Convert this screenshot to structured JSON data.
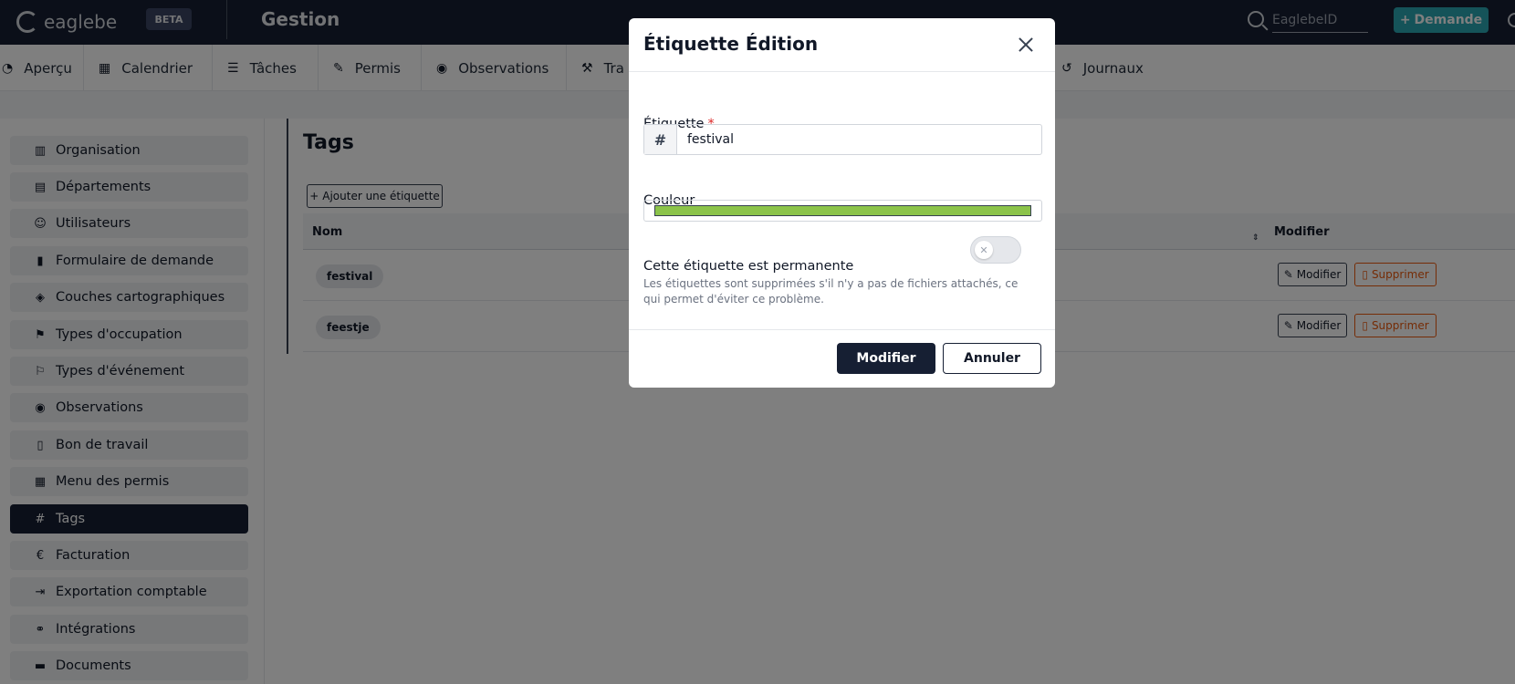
{
  "header": {
    "brand": "eaglebe",
    "beta_label": "BETA",
    "app_title": "Gestion",
    "search_placeholder": "EaglebeID",
    "demande_label": "Demande"
  },
  "nav": {
    "tabs": [
      {
        "label": "Aperçu",
        "icon": "gauge-icon"
      },
      {
        "label": "Calendrier",
        "icon": "calendar-icon"
      },
      {
        "label": "Tâches",
        "icon": "list-check-icon"
      },
      {
        "label": "Permis",
        "icon": "file-signature-icon"
      },
      {
        "label": "Observations",
        "icon": "eye-icon"
      },
      {
        "label": "Tra",
        "icon": "worker-icon"
      },
      {
        "label": "Journaux",
        "icon": "history-icon"
      }
    ]
  },
  "sidebar": {
    "items": [
      {
        "label": "Organisation",
        "icon": "building-icon"
      },
      {
        "label": "Départements",
        "icon": "table-icon"
      },
      {
        "label": "Utilisateurs",
        "icon": "users-icon"
      },
      {
        "label": "Formulaire de demande",
        "icon": "clipboard-icon"
      },
      {
        "label": "Couches cartographiques",
        "icon": "layers-icon"
      },
      {
        "label": "Types d'occupation",
        "icon": "signs-icon"
      },
      {
        "label": "Types d'événement",
        "icon": "flag-icon"
      },
      {
        "label": "Observations",
        "icon": "eye-icon"
      },
      {
        "label": "Bon de travail",
        "icon": "file-icon"
      },
      {
        "label": "Menu des permis",
        "icon": "grid-icon"
      },
      {
        "label": "Tags",
        "icon": "hashtag-icon",
        "active": true
      },
      {
        "label": "Facturation",
        "icon": "euro-icon"
      },
      {
        "label": "Exportation comptable",
        "icon": "file-export-icon"
      },
      {
        "label": "Intégrations",
        "icon": "handshake-icon"
      },
      {
        "label": "Documents",
        "icon": "folder-icon"
      }
    ]
  },
  "main": {
    "title": "Tags",
    "add_label": "Ajouter une étiquette",
    "columns": {
      "name": "Nom",
      "modify": "Modifier"
    },
    "rows": [
      {
        "tag": "festival",
        "edit_label": "Modifier",
        "delete_label": "Supprimer"
      },
      {
        "tag": "feestje",
        "edit_label": "Modifier",
        "delete_label": "Supprimer"
      }
    ]
  },
  "modal": {
    "title": "Étiquette Édition",
    "tag_label": "Étiquette",
    "required_mark": "*",
    "hash_prefix": "#",
    "tag_value": "festival",
    "color_label": "Couleur",
    "color_value": "#8bc34a",
    "permanent_label": "Cette étiquette est permanente",
    "permanent_on": false,
    "help_text": "Les étiquettes sont supprimées s'il n'y a pas de fichiers attachés, ce qui permet d'éviter ce problème.",
    "submit_label": "Modifier",
    "cancel_label": "Annuler"
  },
  "colors": {
    "navy": "#161f33",
    "teal": "#2aa7b3",
    "danger": "#ea580c",
    "tag_color": "#8bc34a"
  }
}
